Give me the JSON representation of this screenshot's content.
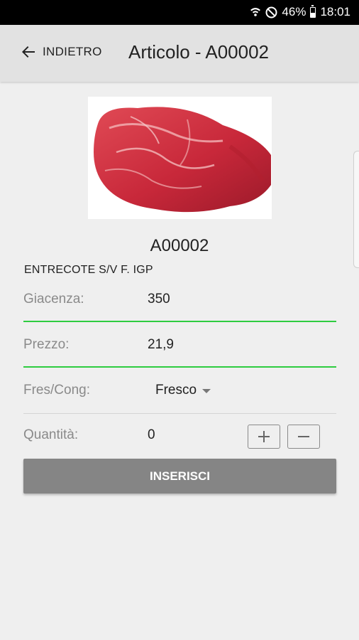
{
  "statusbar": {
    "battery": "46%",
    "time": "18:01",
    "icons": [
      "wifi-icon",
      "do-not-disturb-icon",
      "battery-icon"
    ]
  },
  "appbar": {
    "back_label": "INDIETRO",
    "title": "Articolo - A00002"
  },
  "product": {
    "image": "raw-beef-entrecote",
    "code": "A00002",
    "description": "ENTRECOTE S/V F. IGP"
  },
  "form": {
    "stock_label": "Giacenza:",
    "stock_value": "350",
    "price_label": "Prezzo:",
    "price_value": "21,9",
    "type_label": "Fres/Cong:",
    "type_value": "Fresco",
    "qty_label": "Quantità:",
    "qty_value": "0"
  },
  "actions": {
    "insert_label": "INSERISCI"
  },
  "colors": {
    "accent_line": "#2ecc40",
    "button": "#858585",
    "appbar": "#e2e2e2",
    "background": "#efefef"
  }
}
